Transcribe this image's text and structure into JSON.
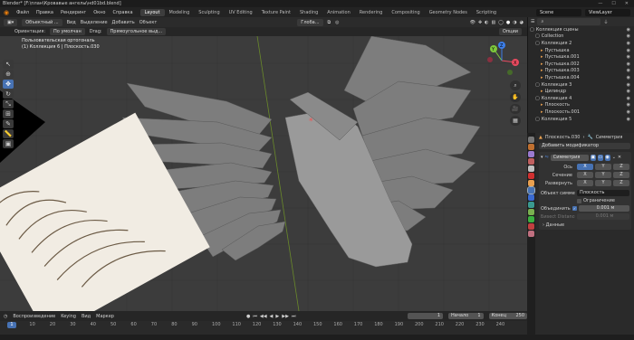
{
  "titlebar": {
    "text": "Blender* [F:\\план\\Кровавые ангелы\\нd01bd.blend]"
  },
  "menu": {
    "items": [
      "Файл",
      "Правка",
      "Рендеринг",
      "Окно",
      "Справка"
    ],
    "tabs": [
      "Layout",
      "Modeling",
      "Sculpting",
      "UV Editing",
      "Texture Paint",
      "Shading",
      "Animation",
      "Rendering",
      "Compositing",
      "Geometry Nodes",
      "Scripting"
    ],
    "scene": "Scene",
    "view_layer": "ViewLayer"
  },
  "header": {
    "mode": "Объектный ...",
    "view": "Вид",
    "select": "Выделение",
    "add": "Добавить",
    "object": "Объект",
    "pivot": "Глоба...",
    "options": "Опции"
  },
  "tool_settings": {
    "orientation_label": "Ориентация:",
    "orientation": "По умолчан",
    "drag_label": "Drag:",
    "drag": "Прямоугольное выд..."
  },
  "viewport": {
    "overlay_line1": "Пользовательская ортогональ",
    "overlay_line2": "(1) Коллекция 6 | Плоскость.030"
  },
  "gizmo": {
    "x": "X",
    "y": "Y",
    "z": "Z"
  },
  "timeline": {
    "playback": "Воспроизведение",
    "keying": "Keying",
    "view": "Вид",
    "marker": "Маркер",
    "current_frame": "1",
    "start_label": "Начало",
    "start": "1",
    "end_label": "Конец",
    "end": "250",
    "ticks": [
      "10",
      "20",
      "30",
      "40",
      "50",
      "60",
      "70",
      "80",
      "90",
      "100",
      "110",
      "120",
      "130",
      "140",
      "150",
      "160",
      "170",
      "180",
      "190",
      "200",
      "210",
      "220",
      "230",
      "240"
    ]
  },
  "outliner": {
    "rows": [
      {
        "label": "Коллекция сцены",
        "indent": 0
      },
      {
        "label": "Collection",
        "indent": 1
      },
      {
        "label": "Коллекция 2",
        "indent": 1
      },
      {
        "label": "Пустышка",
        "indent": 2
      },
      {
        "label": "Пустышка.001",
        "indent": 2
      },
      {
        "label": "Пустышка.002",
        "indent": 2
      },
      {
        "label": "Пустышка.003",
        "indent": 2
      },
      {
        "label": "Пустышка.004",
        "indent": 2
      },
      {
        "label": "Коллекция 3",
        "indent": 1
      },
      {
        "label": "Цилиндр",
        "indent": 2
      },
      {
        "label": "Коллекция 4",
        "indent": 1
      },
      {
        "label": "Плоскость",
        "indent": 2
      },
      {
        "label": "Плоскость.001",
        "indent": 2
      },
      {
        "label": "Коллекция 5",
        "indent": 1
      }
    ]
  },
  "properties": {
    "object": "Плоскость.030",
    "modifier_tab": "Симметрия",
    "add_modifier": "Добавить модификатор",
    "modifier_name": "Симметрия",
    "axis_label": "Ось",
    "bisect_label": "Сечение",
    "flip_label": "Развернуть",
    "axes": [
      "X",
      "Y",
      "Z"
    ],
    "mirror_object_label": "Объект симметр...",
    "mirror_object": "Плоскость",
    "clipping_label": "Ограничение",
    "merge_label": "Объединить",
    "merge_value": "0.001 м",
    "bisect_distance_label": "Биsect Distance",
    "bisect_distance": "0.001 м",
    "data_label": "Данные"
  },
  "colors": {
    "accent": "#4772b3",
    "orange": "#e87d0d",
    "bg": "#3c3c3c"
  }
}
